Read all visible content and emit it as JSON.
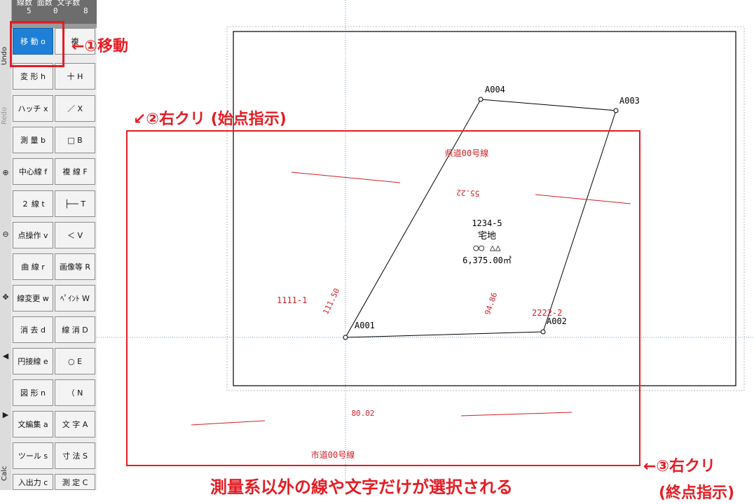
{
  "status_bar": {
    "header": "線数 面数 文字数",
    "lines": "5",
    "faces": "0",
    "chars": "8"
  },
  "side_strip": {
    "undo": "Undo",
    "redo": "Redo",
    "calc": "Calc"
  },
  "toolbar": [
    {
      "label": "移 動 o",
      "active": true
    },
    {
      "label": "複",
      "active": false
    },
    {
      "label": "変 形 h"
    },
    {
      "label": "十 H"
    },
    {
      "label": "ハッチ x"
    },
    {
      "label": "／ X"
    },
    {
      "label": "測 量 b"
    },
    {
      "label": "□ B"
    },
    {
      "label": "中心線 f"
    },
    {
      "label": "複 線 F"
    },
    {
      "label": "２ 線 t"
    },
    {
      "label": "├── T"
    },
    {
      "label": "点操作 v"
    },
    {
      "label": "＜ V"
    },
    {
      "label": "曲 線 r"
    },
    {
      "label": "画像等 R"
    },
    {
      "label": "線変更 w"
    },
    {
      "label": "ﾍﾟｲﾝﾄ W"
    },
    {
      "label": "消 去 d"
    },
    {
      "label": "線 消 D"
    },
    {
      "label": "円接線 e"
    },
    {
      "label": "○ E"
    },
    {
      "label": "図 形 n"
    },
    {
      "label": "（ N"
    },
    {
      "label": "文編集 a"
    },
    {
      "label": "文 字 A"
    },
    {
      "label": "ツール s"
    },
    {
      "label": "寸 法 S"
    },
    {
      "label": "入出力 c"
    },
    {
      "label": "測 定 C"
    }
  ],
  "drawing": {
    "points": {
      "A001": "A001",
      "A002": "A002",
      "A003": "A003",
      "A004": "A004"
    },
    "parcel_number": "1234-5",
    "land_use": "宅地",
    "owner": "○○ △△",
    "area": "6,375.00㎡",
    "road_north": "県道00号線",
    "road_south": "市道00号線",
    "neighbor_west": "1111-1",
    "neighbor_east": "2222-2",
    "dim_top": "55.22",
    "dim_left": "111.50",
    "dim_right": "94.86",
    "dim_bottom": "80.02"
  },
  "annotations": {
    "step1": "←①移動",
    "step2": "↙②右クリ (始点指示)",
    "step3_line1": "←③右クリ",
    "step3_line2": "(終点指示)",
    "caption": "測量系以外の線や文字だけが選択される"
  },
  "colors": {
    "accent": "#e41c24",
    "active_button": "#1e7fd6",
    "dim_red": "#d21f26"
  }
}
